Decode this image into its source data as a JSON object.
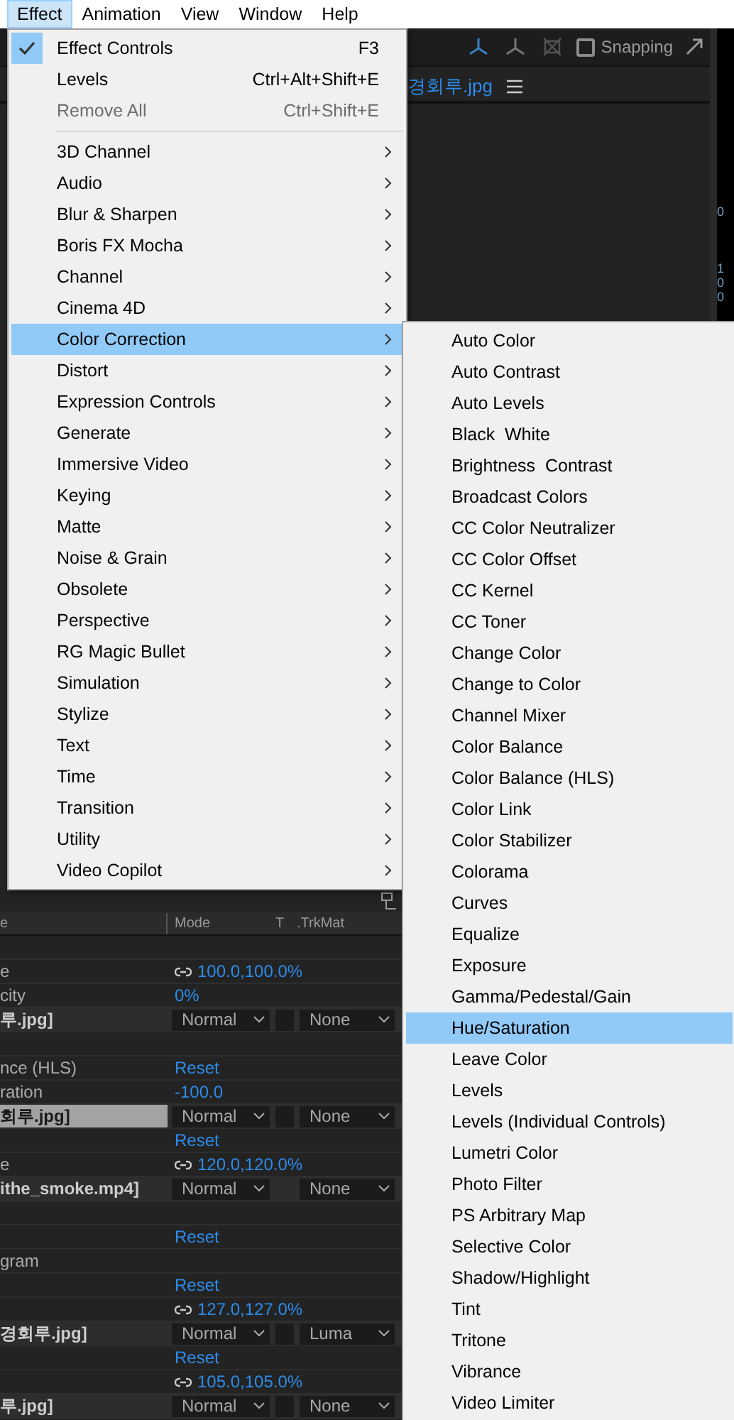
{
  "menubar": [
    {
      "label": "Effect",
      "selected": true
    },
    {
      "label": "Animation",
      "selected": false
    },
    {
      "label": "View",
      "selected": false
    },
    {
      "label": "Window",
      "selected": false
    },
    {
      "label": "Help",
      "selected": false
    }
  ],
  "toolbar": {
    "snapping": {
      "label": "Snapping",
      "checked": false
    }
  },
  "composition": {
    "tab_title": "경회루.jpg"
  },
  "ruler": {
    "labels": [
      "0",
      "100"
    ]
  },
  "effect_menu": {
    "items": [
      {
        "label": "Effect Controls",
        "shortcut": "F3",
        "checked": true,
        "disabled": false,
        "submenu": false,
        "selected": false
      },
      {
        "label": "Levels",
        "shortcut": "Ctrl+Alt+Shift+E",
        "checked": false,
        "disabled": false,
        "submenu": false,
        "selected": false
      },
      {
        "label": "Remove All",
        "shortcut": "Ctrl+Shift+E",
        "checked": false,
        "disabled": true,
        "submenu": false,
        "selected": false,
        "separator_after": true
      },
      {
        "label": "3D Channel",
        "checked": false,
        "disabled": false,
        "submenu": true,
        "selected": false
      },
      {
        "label": "Audio",
        "checked": false,
        "disabled": false,
        "submenu": true,
        "selected": false
      },
      {
        "label": "Blur & Sharpen",
        "checked": false,
        "disabled": false,
        "submenu": true,
        "selected": false
      },
      {
        "label": "Boris FX Mocha",
        "checked": false,
        "disabled": false,
        "submenu": true,
        "selected": false
      },
      {
        "label": "Channel",
        "checked": false,
        "disabled": false,
        "submenu": true,
        "selected": false
      },
      {
        "label": "Cinema 4D",
        "checked": false,
        "disabled": false,
        "submenu": true,
        "selected": false
      },
      {
        "label": "Color Correction",
        "checked": false,
        "disabled": false,
        "submenu": true,
        "selected": true
      },
      {
        "label": "Distort",
        "checked": false,
        "disabled": false,
        "submenu": true,
        "selected": false
      },
      {
        "label": "Expression Controls",
        "checked": false,
        "disabled": false,
        "submenu": true,
        "selected": false
      },
      {
        "label": "Generate",
        "checked": false,
        "disabled": false,
        "submenu": true,
        "selected": false
      },
      {
        "label": "Immersive Video",
        "checked": false,
        "disabled": false,
        "submenu": true,
        "selected": false
      },
      {
        "label": "Keying",
        "checked": false,
        "disabled": false,
        "submenu": true,
        "selected": false
      },
      {
        "label": "Matte",
        "checked": false,
        "disabled": false,
        "submenu": true,
        "selected": false
      },
      {
        "label": "Noise & Grain",
        "checked": false,
        "disabled": false,
        "submenu": true,
        "selected": false
      },
      {
        "label": "Obsolete",
        "checked": false,
        "disabled": false,
        "submenu": true,
        "selected": false
      },
      {
        "label": "Perspective",
        "checked": false,
        "disabled": false,
        "submenu": true,
        "selected": false
      },
      {
        "label": "RG Magic Bullet",
        "checked": false,
        "disabled": false,
        "submenu": true,
        "selected": false
      },
      {
        "label": "Simulation",
        "checked": false,
        "disabled": false,
        "submenu": true,
        "selected": false
      },
      {
        "label": "Stylize",
        "checked": false,
        "disabled": false,
        "submenu": true,
        "selected": false
      },
      {
        "label": "Text",
        "checked": false,
        "disabled": false,
        "submenu": true,
        "selected": false
      },
      {
        "label": "Time",
        "checked": false,
        "disabled": false,
        "submenu": true,
        "selected": false
      },
      {
        "label": "Transition",
        "checked": false,
        "disabled": false,
        "submenu": true,
        "selected": false
      },
      {
        "label": "Utility",
        "checked": false,
        "disabled": false,
        "submenu": true,
        "selected": false
      },
      {
        "label": "Video Copilot",
        "checked": false,
        "disabled": false,
        "submenu": true,
        "selected": false
      }
    ]
  },
  "color_correction_menu": {
    "items": [
      {
        "label": "Auto Color",
        "selected": false
      },
      {
        "label": "Auto Contrast",
        "selected": false
      },
      {
        "label": "Auto Levels",
        "selected": false
      },
      {
        "label": "Black  White",
        "selected": false
      },
      {
        "label": "Brightness  Contrast",
        "selected": false
      },
      {
        "label": "Broadcast Colors",
        "selected": false
      },
      {
        "label": "CC Color Neutralizer",
        "selected": false
      },
      {
        "label": "CC Color Offset",
        "selected": false
      },
      {
        "label": "CC Kernel",
        "selected": false
      },
      {
        "label": "CC Toner",
        "selected": false
      },
      {
        "label": "Change Color",
        "selected": false
      },
      {
        "label": "Change to Color",
        "selected": false
      },
      {
        "label": "Channel Mixer",
        "selected": false
      },
      {
        "label": "Color Balance",
        "selected": false
      },
      {
        "label": "Color Balance (HLS)",
        "selected": false
      },
      {
        "label": "Color Link",
        "selected": false
      },
      {
        "label": "Color Stabilizer",
        "selected": false
      },
      {
        "label": "Colorama",
        "selected": false
      },
      {
        "label": "Curves",
        "selected": false
      },
      {
        "label": "Equalize",
        "selected": false
      },
      {
        "label": "Exposure",
        "selected": false
      },
      {
        "label": "Gamma/Pedestal/Gain",
        "selected": false
      },
      {
        "label": "Hue/Saturation",
        "selected": true
      },
      {
        "label": "Leave Color",
        "selected": false
      },
      {
        "label": "Levels",
        "selected": false
      },
      {
        "label": "Levels (Individual Controls)",
        "selected": false
      },
      {
        "label": "Lumetri Color",
        "selected": false
      },
      {
        "label": "Photo Filter",
        "selected": false
      },
      {
        "label": "PS Arbitrary Map",
        "selected": false
      },
      {
        "label": "Selective Color",
        "selected": false
      },
      {
        "label": "Shadow/Highlight",
        "selected": false
      },
      {
        "label": "Tint",
        "selected": false
      },
      {
        "label": "Tritone",
        "selected": false
      },
      {
        "label": "Vibrance",
        "selected": false
      },
      {
        "label": "Video Limiter",
        "selected": false
      }
    ]
  },
  "timeline": {
    "columns": [
      "e",
      "Mode",
      "T",
      ".TrkMat"
    ],
    "rows": [
      {
        "kind": "property",
        "name": "e",
        "value": "100.0,100.0%",
        "linked": true
      },
      {
        "kind": "property",
        "name": "city",
        "value": "0%",
        "linked": false
      },
      {
        "kind": "layer",
        "name": "루.jpg]",
        "mode": "Normal",
        "trkmat": "None",
        "selected": false,
        "t_box": true
      },
      {
        "kind": "property"
      },
      {
        "kind": "property",
        "name": "nce (HLS)",
        "value": "Reset",
        "linked": false
      },
      {
        "kind": "property",
        "name": "ration",
        "value": "-100.0",
        "linked": false
      },
      {
        "kind": "layer",
        "name": "회루.jpg]",
        "mode": "Normal",
        "trkmat": "None",
        "selected": true,
        "t_box": true
      },
      {
        "kind": "property",
        "value": "Reset",
        "linked": false
      },
      {
        "kind": "property",
        "name": "e",
        "value": "120.0,120.0%",
        "linked": true
      },
      {
        "kind": "layer",
        "name": "ithe_smoke.mp4]",
        "mode": "Normal",
        "trkmat": "None",
        "selected": false,
        "t_box": false
      },
      {
        "kind": "property"
      },
      {
        "kind": "property",
        "value": "Reset",
        "linked": false
      },
      {
        "kind": "property",
        "name": "gram"
      },
      {
        "kind": "property",
        "value": "Reset",
        "linked": false
      },
      {
        "kind": "property",
        "value": "127.0,127.0%",
        "linked": true
      },
      {
        "kind": "layer",
        "name": "경회루.jpg]",
        "mode": "Normal",
        "trkmat": "Luma",
        "selected": false,
        "t_box": true
      },
      {
        "kind": "property",
        "value": "Reset",
        "linked": false
      },
      {
        "kind": "property",
        "value": "105.0,105.0%",
        "linked": true
      },
      {
        "kind": "layer",
        "name": "루.jpg]",
        "mode": "Normal",
        "trkmat": "None",
        "selected": false,
        "t_box": true
      }
    ]
  }
}
